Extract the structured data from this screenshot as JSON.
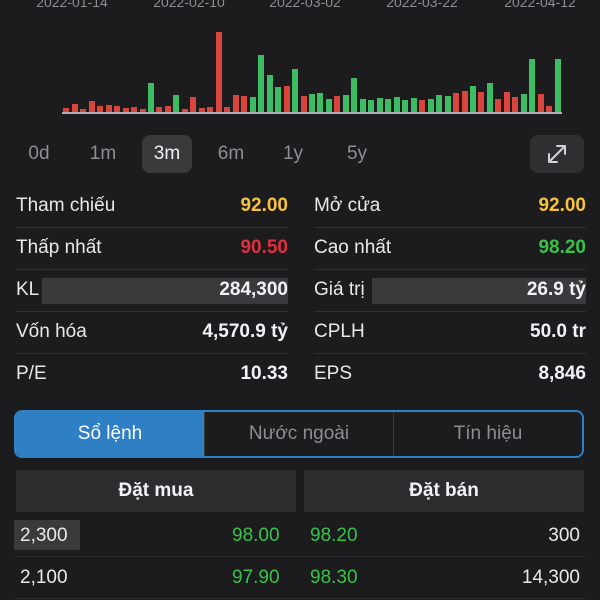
{
  "chart": {
    "date_labels": [
      "2022-01-14",
      "2022-02-10",
      "2022-03-02",
      "2022-03-22",
      "2022-04-12"
    ]
  },
  "chart_data": {
    "type": "bar",
    "title": "",
    "xlabel": "",
    "ylabel": "",
    "values": [
      4,
      8,
      3,
      10,
      6,
      7,
      6,
      4,
      5,
      3,
      28,
      5,
      6,
      16,
      3,
      14,
      4,
      5,
      76,
      5,
      16,
      15,
      14,
      54,
      35,
      24,
      25,
      41,
      15,
      17,
      18,
      12,
      15,
      16,
      32,
      12,
      11,
      13,
      12,
      14,
      11,
      13,
      11,
      12,
      16,
      15,
      18,
      20,
      25,
      19,
      28,
      12,
      19,
      14,
      17,
      50,
      17,
      6,
      50
    ],
    "colors": [
      "r",
      "r",
      "r",
      "r",
      "r",
      "r",
      "r",
      "r",
      "r",
      "r",
      "g",
      "r",
      "r",
      "g",
      "r",
      "r",
      "r",
      "r",
      "r",
      "r",
      "r",
      "r",
      "g",
      "g",
      "g",
      "g",
      "r",
      "g",
      "r",
      "g",
      "g",
      "g",
      "r",
      "g",
      "g",
      "g",
      "g",
      "g",
      "g",
      "g",
      "g",
      "g",
      "r",
      "g",
      "g",
      "g",
      "r",
      "r",
      "g",
      "r",
      "g",
      "r",
      "r",
      "r",
      "g",
      "g",
      "r",
      "r",
      "g"
    ],
    "color_map": {
      "g": "#3dbd63",
      "r": "#d9453c"
    },
    "x_range": [
      "2022-01-14",
      "2022-04-12"
    ]
  },
  "ranges": {
    "items": [
      {
        "label": "0d",
        "active": false
      },
      {
        "label": "1m",
        "active": false
      },
      {
        "label": "3m",
        "active": true
      },
      {
        "label": "6m",
        "active": false
      },
      {
        "label": "1y",
        "active": false
      },
      {
        "label": "5y",
        "active": false
      }
    ]
  },
  "stats": {
    "left": [
      {
        "label": "Tham chiếu",
        "value": "92.00",
        "tone": "yellow"
      },
      {
        "label": "Thấp nhất",
        "value": "90.50",
        "tone": "red"
      },
      {
        "label": "KL",
        "value": "284,300",
        "tone": "white",
        "masked": true
      },
      {
        "label": "Vốn hóa",
        "value": "4,570.9 tỷ",
        "tone": "white"
      },
      {
        "label": "P/E",
        "value": "10.33",
        "tone": "white"
      }
    ],
    "right": [
      {
        "label": "Mở cửa",
        "value": "92.00",
        "tone": "yellow"
      },
      {
        "label": "Cao nhất",
        "value": "98.20",
        "tone": "green"
      },
      {
        "label": "Giá trị",
        "value": "26.9 tỷ",
        "tone": "white",
        "masked": true
      },
      {
        "label": "CPLH",
        "value": "50.0 tr",
        "tone": "white"
      },
      {
        "label": "EPS",
        "value": "8,846",
        "tone": "white"
      }
    ]
  },
  "tabs": [
    {
      "label": "Sổ lệnh",
      "active": true
    },
    {
      "label": "Nước ngoài",
      "active": false
    },
    {
      "label": "Tín hiệu",
      "active": false
    }
  ],
  "orderbook": {
    "buy_header": "Đặt mua",
    "sell_header": "Đặt bán",
    "rows": [
      {
        "buy_qty": "2,300",
        "buy_price": "98.00",
        "sell_price": "98.20",
        "sell_qty": "300",
        "highlight": true
      },
      {
        "buy_qty": "2,100",
        "buy_price": "97.90",
        "sell_price": "98.30",
        "sell_qty": "14,300",
        "highlight": false
      }
    ]
  },
  "colors": {
    "background": "#1c1c1e",
    "accent": "#2e7fc4",
    "up": "#38c24a",
    "down": "#e0303d",
    "reference": "#f5c242"
  }
}
